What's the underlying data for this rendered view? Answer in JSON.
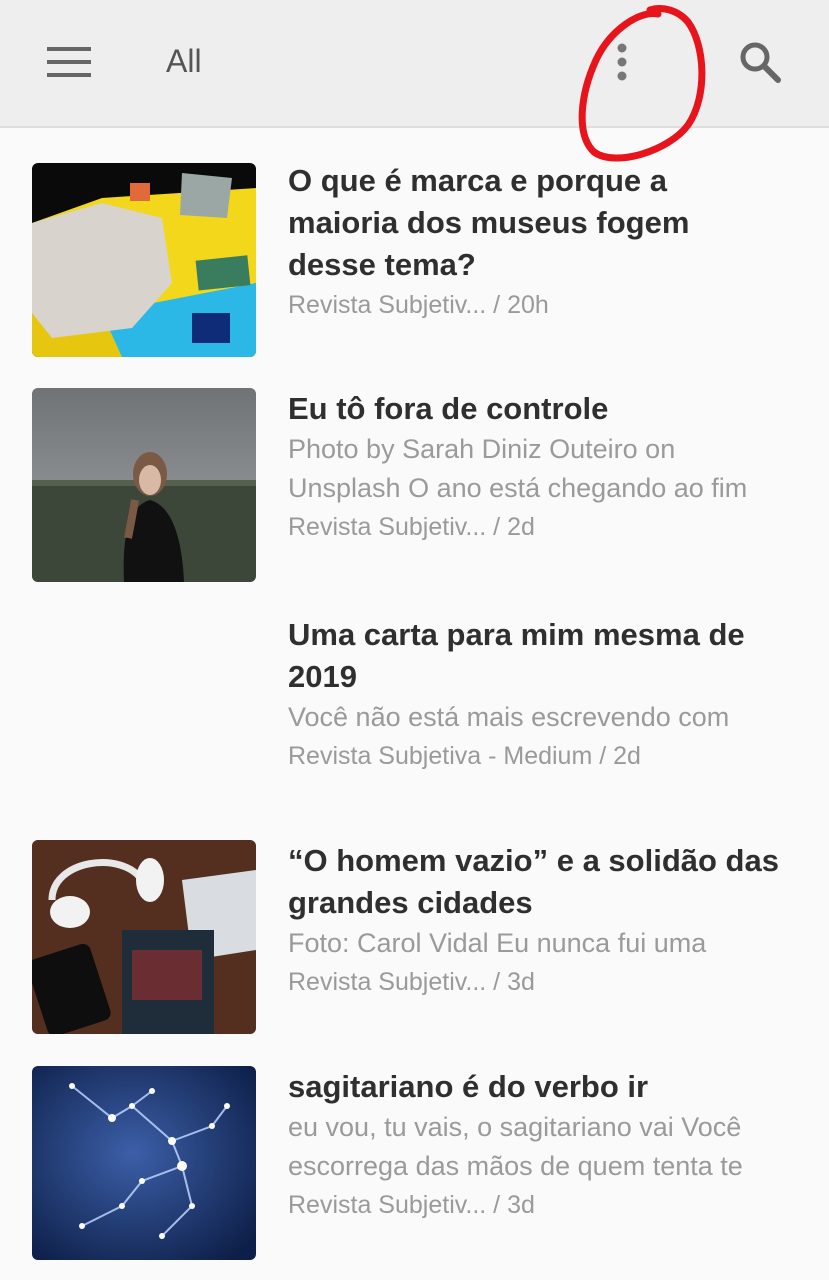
{
  "appbar": {
    "title": "All",
    "icons": [
      "menu-icon",
      "more-vert-icon",
      "search-icon"
    ]
  },
  "colors": {
    "appbar_bg": "#eeeeee",
    "title_text": "#2f2f2f",
    "secondary_text": "#9a9a9a",
    "annotation": "#e8141c"
  },
  "items": [
    {
      "title_lines": [
        "O que é marca e porque a",
        "maioria dos museus fogem",
        "desse tema?"
      ],
      "snippet_lines": [],
      "meta": "Revista Subjetiv... / 20h",
      "has_image": true
    },
    {
      "title_lines": [
        "Eu tô fora de controle"
      ],
      "snippet_lines": [
        "Photo by Sarah Diniz Outeiro on",
        "Unsplash O ano está chegando ao fim"
      ],
      "meta": "Revista Subjetiv... / 2d",
      "has_image": true
    },
    {
      "title_lines": [
        "Uma carta para mim mesma de",
        "2019"
      ],
      "snippet_lines": [
        "Você não está mais escrevendo com"
      ],
      "meta": "Revista Subjetiva - Medium / 2d",
      "has_image": false
    },
    {
      "title_lines": [
        "“O homem vazio” e a solidão das",
        "grandes cidades"
      ],
      "snippet_lines": [
        "Foto: Carol Vidal Eu nunca fui uma"
      ],
      "meta": "Revista Subjetiv... / 3d",
      "has_image": true
    },
    {
      "title_lines": [
        "sagitariano é do verbo ir"
      ],
      "snippet_lines": [
        "eu vou, tu vais, o sagitariano vai Você",
        "escorrega das mãos de quem tenta te"
      ],
      "meta": "Revista Subjetiv... / 3d",
      "has_image": true
    }
  ]
}
